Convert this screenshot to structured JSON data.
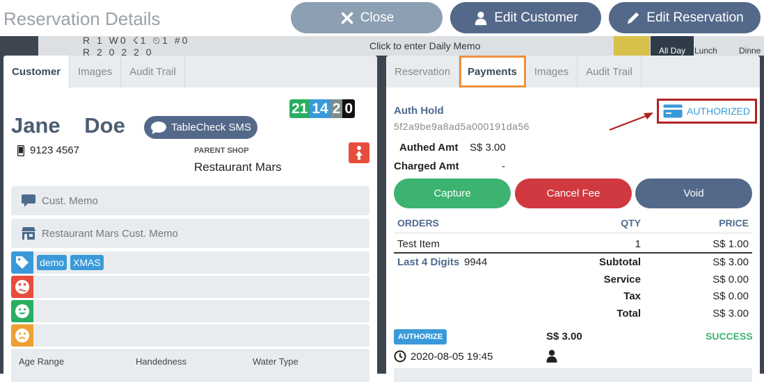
{
  "header": {
    "title": "Reservation Details",
    "close_label": "Close",
    "edit_customer_label": "Edit Customer",
    "edit_reservation_label": "Edit Reservation"
  },
  "background": {
    "memo_text": "Click to enter Daily Memo",
    "stats_line1": "R 1  W0  ☇1  ⏲1  #0",
    "stats_line2": "R 2   0    2    2    0",
    "all_day": "All Day",
    "lunch": "Lunch",
    "dinner": "Dinne"
  },
  "customer_panel": {
    "tabs": [
      "Customer",
      "Images",
      "Audit Trail"
    ],
    "active_tab": "Customer",
    "counts": [
      {
        "value": "21",
        "color": "#27ae60"
      },
      {
        "value": "14",
        "color": "#3a9ad9"
      },
      {
        "value": "2",
        "color": "#7f8c8d"
      },
      {
        "value": "0",
        "color": "#111111"
      }
    ],
    "first_name": "Jane",
    "last_name": "Doe",
    "sms_label": "TableCheck SMS",
    "phone": "9123 4567",
    "parent_shop_label": "PARENT SHOP",
    "parent_shop": "Restaurant Mars",
    "cust_memo_label": "Cust. Memo",
    "shop_memo_label": "Restaurant Mars Cust. Memo",
    "tags": [
      "demo",
      "XMAS"
    ],
    "attributes": [
      {
        "label": "Age Range"
      },
      {
        "label": "Handedness"
      },
      {
        "label": "Water Type"
      }
    ]
  },
  "payment_panel": {
    "tabs": [
      "Reservation",
      "Payments",
      "Images",
      "Audit Trail"
    ],
    "active_tab": "Payments",
    "auth_hold_label": "Auth Hold",
    "auth_id": "5f2a9be9a8ad5a000191da56",
    "status": "AUTHORIZED",
    "authed_amt_label": "Authed Amt",
    "authed_amt": "S$ 3.00",
    "charged_amt_label": "Charged Amt",
    "charged_amt": "-",
    "buttons": {
      "capture": "Capture",
      "cancel_fee": "Cancel Fee",
      "void": "Void"
    },
    "orders_header": {
      "orders": "ORDERS",
      "qty": "QTY",
      "price": "PRICE"
    },
    "orders": [
      {
        "item": "Test Item",
        "qty": "1",
        "price": "S$ 1.00"
      }
    ],
    "last4_label": "Last 4 Digits",
    "last4": "9944",
    "summary": [
      {
        "label": "Subtotal",
        "value": "S$ 3.00"
      },
      {
        "label": "Service",
        "value": "S$ 0.00"
      },
      {
        "label": "Tax",
        "value": "S$ 0.00"
      },
      {
        "label": "Total",
        "value": "S$ 3.00"
      }
    ],
    "transaction": {
      "type": "AUTHORIZE",
      "amount": "S$ 3.00",
      "result": "SUCCESS",
      "datetime": "2020-08-05 19:45"
    }
  }
}
